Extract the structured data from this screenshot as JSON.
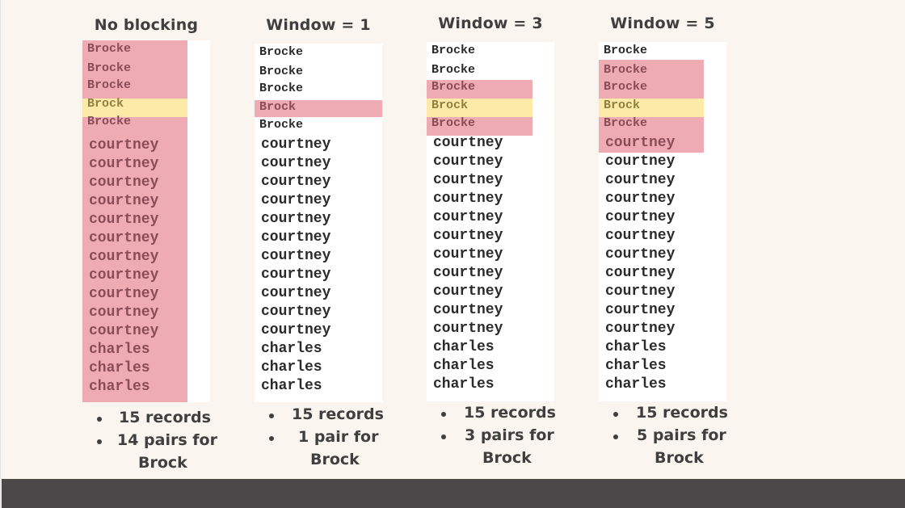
{
  "panels": [
    {
      "title": "No blocking",
      "records": [
        "Brocke",
        "Brocke",
        "Brocke",
        "Brock",
        "Brocke",
        "courtney",
        "courtney",
        "courtney",
        "courtney",
        "courtney",
        "courtney",
        "courtney",
        "courtney",
        "courtney",
        "courtney",
        "courtney",
        "charles",
        "charles",
        "charles"
      ],
      "highlight": {
        "pink_rows": "all",
        "yellow_row": "Brock"
      },
      "bullets": [
        "15 records",
        "14 pairs for",
        "Brock"
      ]
    },
    {
      "title": "Window = 1",
      "records": [
        "Brocke",
        "Brocke",
        "Brocke",
        "Brock",
        "Brocke",
        "courtney",
        "courtney",
        "courtney",
        "courtney",
        "courtney",
        "courtney",
        "courtney",
        "courtney",
        "courtney",
        "courtney",
        "courtney",
        "charles",
        "charles",
        "charles"
      ],
      "highlight": {
        "pink_rows": "Brock only",
        "yellow_row": ""
      },
      "bullets": [
        "15 records",
        "1 pair for",
        "Brock"
      ]
    },
    {
      "title": "Window = 3",
      "records": [
        "Brocke",
        "Brocke",
        "Brocke",
        "Brock",
        "Brocke",
        "courtney",
        "courtney",
        "courtney",
        "courtney",
        "courtney",
        "courtney",
        "courtney",
        "courtney",
        "courtney",
        "courtney",
        "courtney",
        "charles",
        "charles",
        "charles"
      ],
      "highlight": {
        "pink_rows": "rows 3-5",
        "yellow_row": "Brock"
      },
      "bullets": [
        "15 records",
        "3 pairs for",
        "Brock"
      ]
    },
    {
      "title": "Window = 5",
      "records": [
        "Brocke",
        "Brocke",
        "Brocke",
        "Brock",
        "Brocke",
        "courtney",
        "courtney",
        "courtney",
        "courtney",
        "courtney",
        "courtney",
        "courtney",
        "courtney",
        "courtney",
        "courtney",
        "courtney",
        "charles",
        "charles",
        "charles"
      ],
      "highlight": {
        "pink_rows": "rows 2-6",
        "yellow_row": "Brock"
      },
      "bullets": [
        "15 records",
        "5 pairs for",
        "Brock"
      ]
    }
  ],
  "colors": {
    "pink": "#efabb4",
    "yellow": "#fdeaa9",
    "background": "#faf5ef",
    "footer": "#4a4849"
  }
}
